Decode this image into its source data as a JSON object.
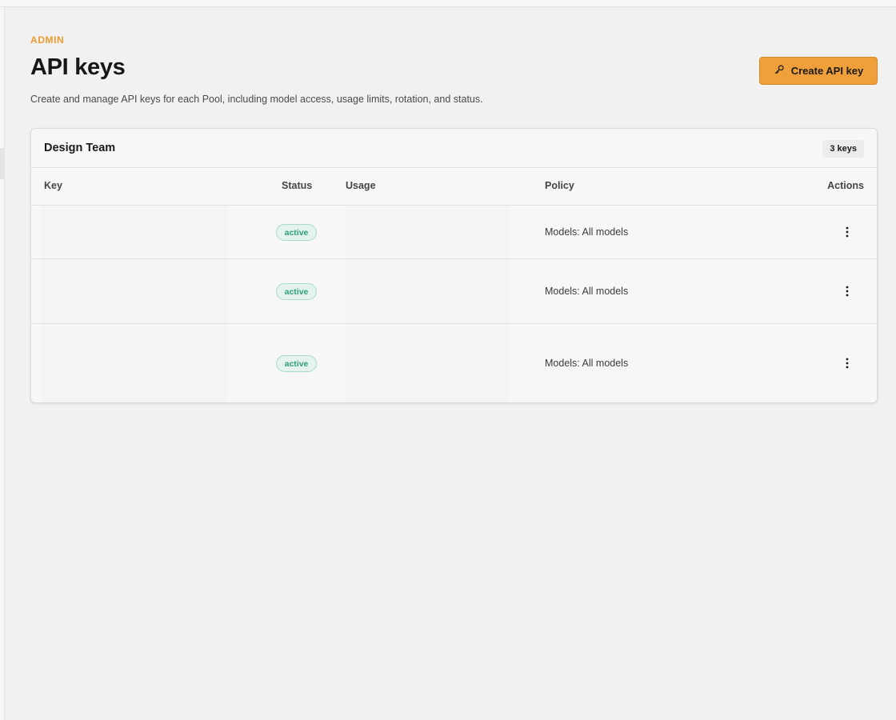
{
  "header": {
    "eyebrow": "ADMIN",
    "title": "API keys",
    "description": "Create and manage API keys for each Pool, including model access, usage limits, rotation, and status.",
    "create_button_label": "Create API key",
    "create_button_icon": "key-icon"
  },
  "pool": {
    "name": "Design Team",
    "key_count_label": "3 keys"
  },
  "table": {
    "columns": {
      "key": "Key",
      "status": "Status",
      "usage": "Usage",
      "policy": "Policy",
      "actions": "Actions"
    },
    "rows": [
      {
        "status": "active",
        "policy": "Models: All models",
        "actions_icon": "more-vertical-icon"
      },
      {
        "status": "active",
        "policy": "Models: All models",
        "actions_icon": "more-vertical-icon"
      },
      {
        "status": "active",
        "policy": "Models: All models",
        "actions_icon": "more-vertical-icon"
      }
    ]
  },
  "colors": {
    "accent": "#f0a03a",
    "eyebrow": "#ee9a30",
    "status_active_text": "#2f9e7c",
    "status_active_bg": "#e4f3ed",
    "page_bg": "#f1f1f1",
    "card_bg": "#f7f7f7"
  }
}
